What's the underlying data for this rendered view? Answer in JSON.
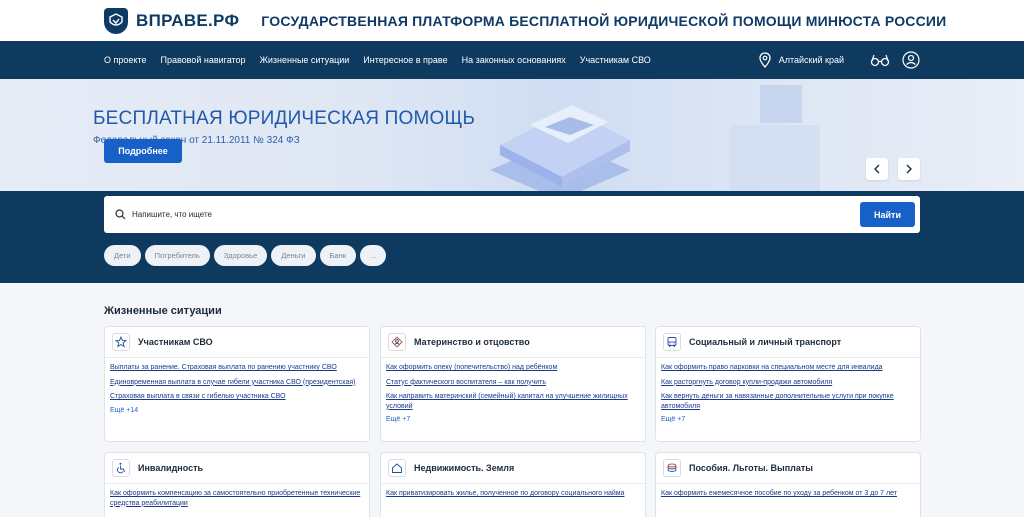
{
  "header": {
    "brand": "ВПРАВЕ.РФ",
    "platform_title": "ГОСУДАРСТВЕННАЯ ПЛАТФОРМА БЕСПЛАТНОЙ ЮРИДИЧЕСКОЙ ПОМОЩИ МИНЮСТА РОССИИ"
  },
  "nav": {
    "items": [
      "О проекте",
      "Правовой навигатор",
      "Жизненные ситуации",
      "Интересное в праве",
      "На законных основаниях",
      "Участникам СВО"
    ],
    "region": "Алтайский край",
    "icons": [
      "location-pin-icon",
      "accessibility-glasses-icon",
      "user-icon"
    ]
  },
  "hero": {
    "title": "БЕСПЛАТНАЯ ЮРИДИЧЕСКАЯ ПОМОЩЬ",
    "subtitle": "Федеральный закон от 21.11.2011 № 324 ФЗ",
    "button": "Подробнее",
    "prev_icon": "chevron-left-icon",
    "next_icon": "chevron-right-icon"
  },
  "search": {
    "placeholder": "Напишите, что ищете",
    "button": "Найти",
    "chips": [
      "Дети",
      "Потребитель",
      "Здоровье",
      "Деньги",
      "Банк",
      "..."
    ]
  },
  "situations": {
    "title": "Жизненные ситуации",
    "cards": [
      {
        "title": "Участникам СВО",
        "icon": "star-icon",
        "links": [
          "Выплаты за ранение. Страховая выплата по ранению участнику СВО",
          "Единовременная выплата в случае гибели участника СВО (президентская)",
          "Страховая выплата в связи с гибелью участника СВО"
        ],
        "more": "Ещё +14"
      },
      {
        "title": "Материнство и отцовство",
        "icon": "family-icon",
        "links": [
          "Как оформить опеку (попечительство) над ребёнком",
          "Статус фактического воспитателя – как получить",
          "Как направить материнский (семейный) капитал на улучшение жилищных условий"
        ],
        "more": "Ещё +7"
      },
      {
        "title": "Социальный и личный транспорт",
        "icon": "bus-icon",
        "links": [
          "Как оформить право парковки на специальном месте для инвалида",
          "Как расторгнуть договор купли-продажи автомобиля",
          "Как вернуть деньги за навязанные дополнительные услуги при покупке автомобиля"
        ],
        "more": "Ещё +7"
      },
      {
        "title": "Инвалидность",
        "icon": "wheelchair-icon",
        "links": [
          "Как оформить компенсацию за самостоятельно приобретенные технические средства реабилитации"
        ],
        "more": ""
      },
      {
        "title": "Недвижимость. Земля",
        "icon": "house-icon",
        "links": [
          "Как приватизировать жилье, полученное по договору социального найма"
        ],
        "more": ""
      },
      {
        "title": "Пособия. Льготы. Выплаты",
        "icon": "coins-icon",
        "links": [
          "Как оформить ежемесячное пособие по уходу за ребенком от 3 до 7 лет"
        ],
        "more": ""
      }
    ]
  },
  "colors": {
    "navy": "#0e3a5f",
    "accent": "#1660c8",
    "brand": "#0f3a66"
  }
}
